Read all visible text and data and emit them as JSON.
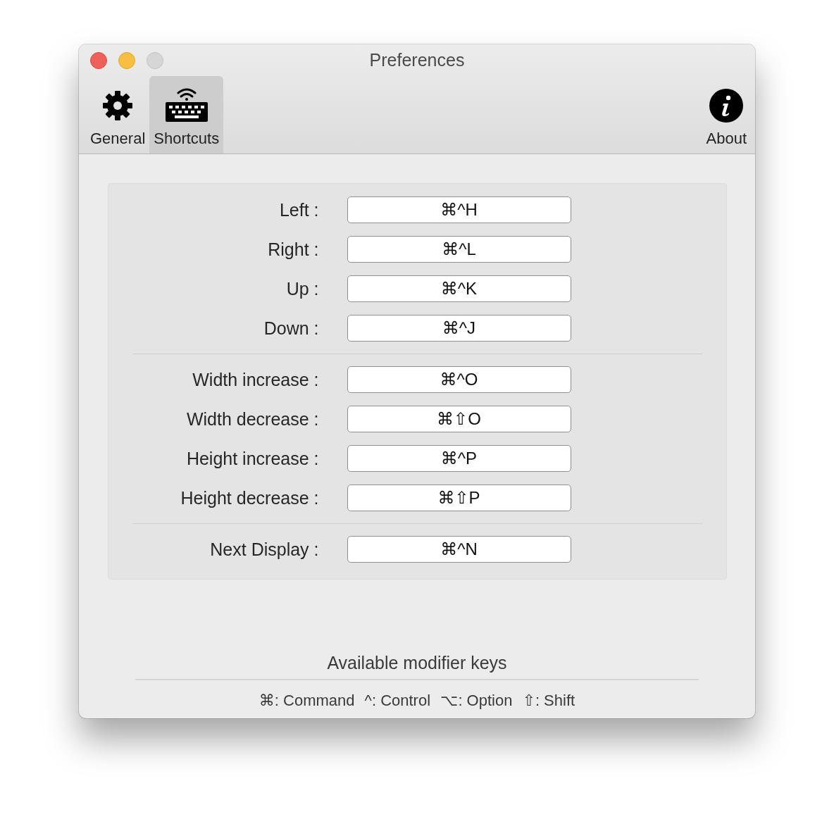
{
  "window": {
    "title": "Preferences"
  },
  "toolbar": [
    {
      "label": "General",
      "kind": "gear",
      "selected": false
    },
    {
      "label": "Shortcuts",
      "kind": "keyboard",
      "selected": true
    },
    {
      "label": "About",
      "kind": "info",
      "selected": false
    }
  ],
  "shortcut_groups": [
    [
      {
        "label": "Left :",
        "value": "⌘^H"
      },
      {
        "label": "Right :",
        "value": "⌘^L"
      },
      {
        "label": "Up :",
        "value": "⌘^K"
      },
      {
        "label": "Down :",
        "value": "⌘^J"
      }
    ],
    [
      {
        "label": "Width increase :",
        "value": "⌘^O"
      },
      {
        "label": "Width decrease :",
        "value": "⌘⇧O"
      },
      {
        "label": "Height increase :",
        "value": "⌘^P"
      },
      {
        "label": "Height decrease :",
        "value": "⌘⇧P"
      }
    ],
    [
      {
        "label": "Next Display :",
        "value": "⌘^N"
      }
    ]
  ],
  "modifiers": {
    "title": "Available modifier keys",
    "items": [
      "⌘: Command",
      "^: Control",
      "⌥: Option",
      "⇧: Shift"
    ]
  }
}
